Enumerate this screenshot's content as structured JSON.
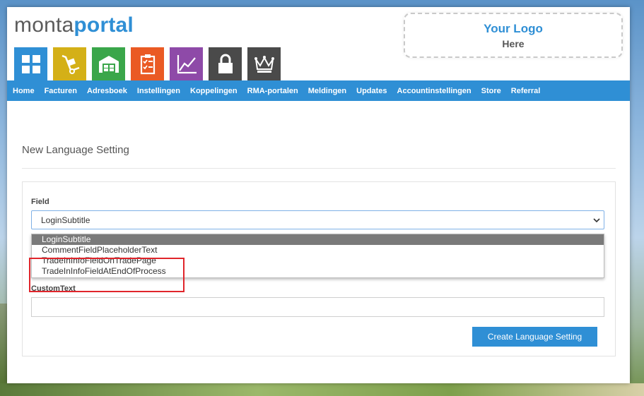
{
  "brand": {
    "part1": "monta",
    "part2": "portal"
  },
  "logo_box": {
    "line1": "Your Logo",
    "line2": "Here"
  },
  "tiles": [
    {
      "icon": "dashboard-grid-icon",
      "color": "#2f8fd5"
    },
    {
      "icon": "hand-truck-icon",
      "color": "#d4b017"
    },
    {
      "icon": "warehouse-icon",
      "color": "#3aa64a"
    },
    {
      "icon": "clipboard-checklist-icon",
      "color": "#ea5a24"
    },
    {
      "icon": "line-chart-icon",
      "color": "#8e4aa8"
    },
    {
      "icon": "lock-icon",
      "color": "#4a4a4a"
    },
    {
      "icon": "crown-icon",
      "color": "#4a4a4a"
    }
  ],
  "nav": [
    "Home",
    "Facturen",
    "Adresboek",
    "Instellingen",
    "Koppelingen",
    "RMA-portalen",
    "Meldingen",
    "Updates",
    "Accountinstellingen",
    "Store",
    "Referral"
  ],
  "page_title": "New Language Setting",
  "form": {
    "field_label": "Field",
    "field_value": "LoginSubtitle",
    "options": [
      "LoginSubtitle",
      "CommentFieldPlaceholderText",
      "TradeInInfoFieldOnTradePage",
      "TradeInInfoFieldAtEndOfProcess"
    ],
    "custom_text_label": "CustomText",
    "custom_text_value": "",
    "submit_label": "Create Language Setting"
  },
  "colors": {
    "accent": "#2f8fd5",
    "highlight": "#e0252b"
  }
}
